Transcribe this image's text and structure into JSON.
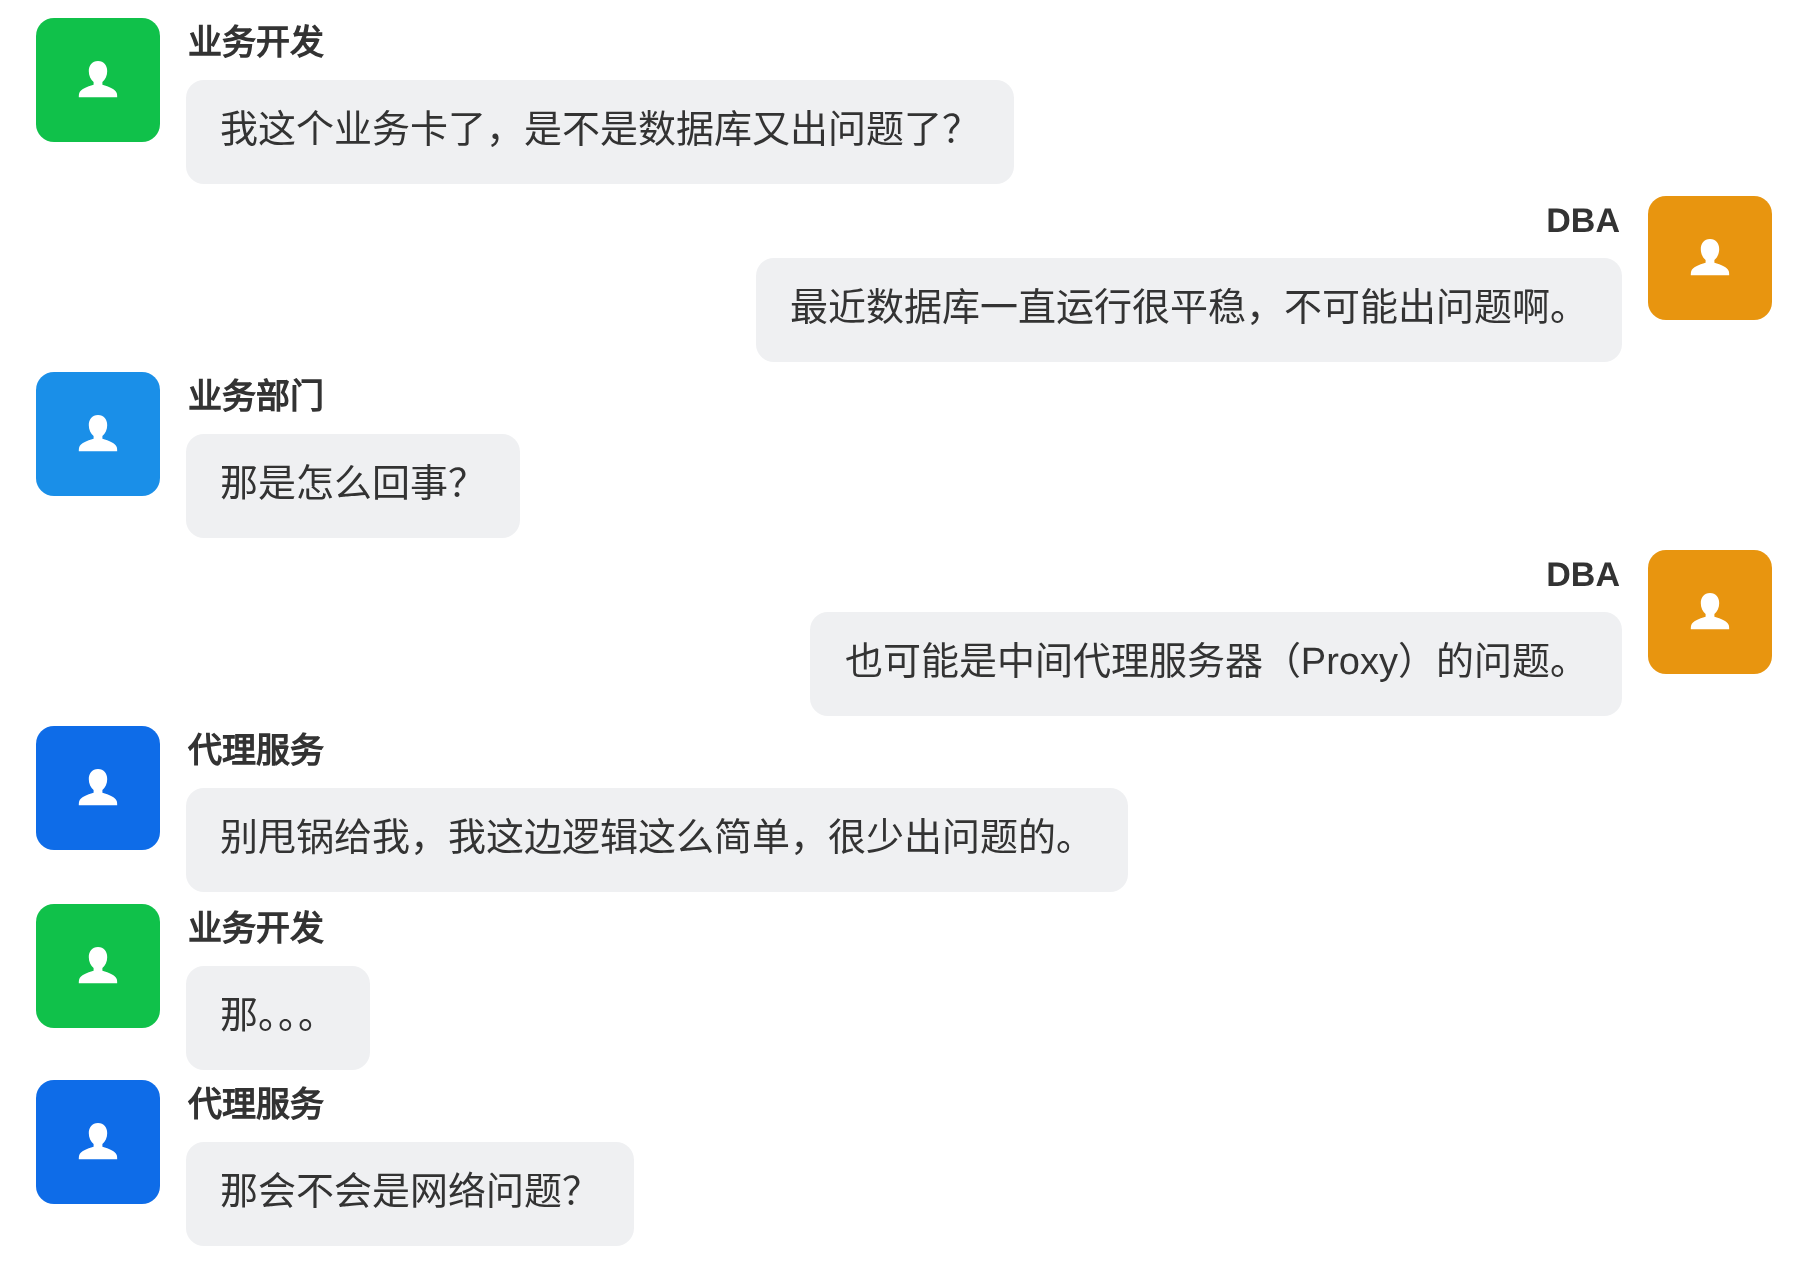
{
  "messages": [
    {
      "sender": "业务开发",
      "kind": "incoming",
      "color": "#10c14a",
      "text": "我这个业务卡了，是不是数据库又出问题了？"
    },
    {
      "sender": "DBA",
      "kind": "outgoing",
      "color": "#e8950f",
      "text": "最近数据库一直运行很平稳，不可能出问题啊。"
    },
    {
      "sender": "业务部门",
      "kind": "incoming",
      "color": "#1a8fe8",
      "text": "那是怎么回事？"
    },
    {
      "sender": "DBA",
      "kind": "outgoing",
      "color": "#e8950f",
      "text": "也可能是中间代理服务器（Proxy）的问题。"
    },
    {
      "sender": "代理服务",
      "kind": "incoming",
      "color": "#0e6ce8",
      "text": "别甩锅给我，我这边逻辑这么简单，很少出问题的。"
    },
    {
      "sender": "业务开发",
      "kind": "incoming",
      "color": "#10c14a",
      "text": "那。。。"
    },
    {
      "sender": "代理服务",
      "kind": "incoming",
      "color": "#0e6ce8",
      "text": "那会不会是网络问题？"
    }
  ]
}
